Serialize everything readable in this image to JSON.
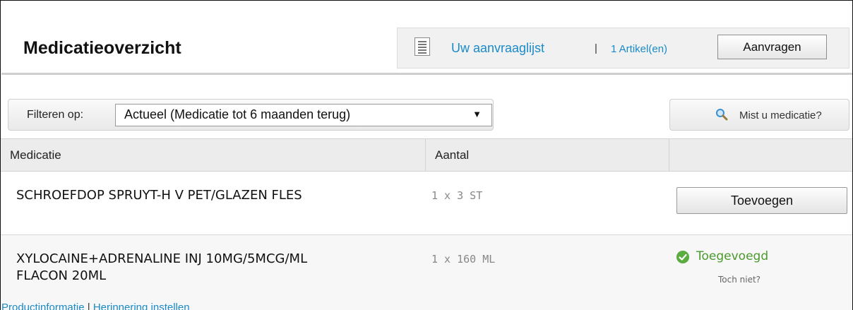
{
  "page": {
    "title": "Medicatieoverzicht"
  },
  "request_list": {
    "icon": "document-list-icon",
    "link_label": "Uw aanvraaglijst",
    "separator": "|",
    "count_label": "1 Artikel(en)",
    "request_button": "Aanvragen"
  },
  "filter": {
    "label": "Filteren op:",
    "selected": "Actueel (Medicatie tot 6 maanden terug)",
    "arrow": "▼"
  },
  "missing": {
    "icon": "search-icon",
    "label": "Mist u medicatie?"
  },
  "table": {
    "columns": [
      "Medicatie",
      "Aantal",
      ""
    ],
    "rows": [
      {
        "name": "SCHROEFDOP SPRUYT-H V PET/GLAZEN FLES",
        "quantity": "1 x 3 ST",
        "action_label": "Toevoegen"
      },
      {
        "name_line1": "XYLOCAINE+ADRENALINE INJ 10MG/5MCG/ML",
        "name_line2": "FLACON 20ML",
        "quantity": "1 x 160 ML",
        "status_label": "Toegevoegd",
        "undo_label": "Toch niet?",
        "links": {
          "product_info": "Productinformatie",
          "separator": "|",
          "reminder": "Herinnering instellen"
        }
      }
    ]
  },
  "colors": {
    "link": "#1a8ac8",
    "success": "#4b9a2c",
    "header_bg": "#ececec"
  }
}
